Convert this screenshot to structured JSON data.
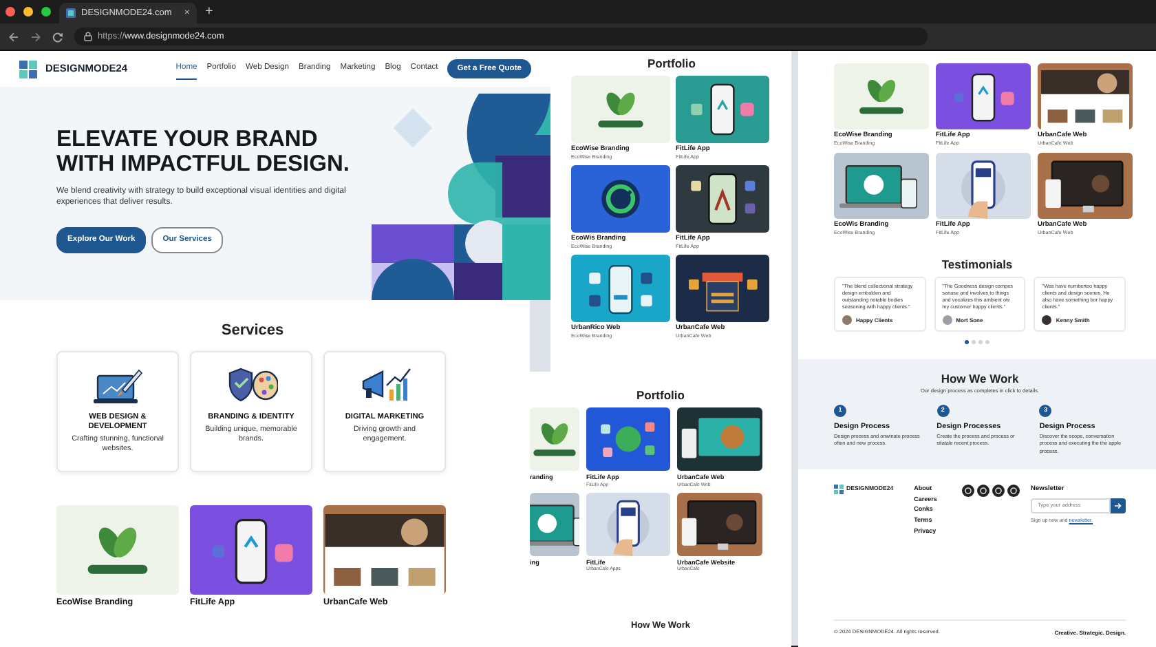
{
  "browser": {
    "tab_title": "DESIGNMODE24.com",
    "tab_close": "×",
    "new_tab": "+",
    "url_scheme": "https://",
    "url_host": "www.designmode24.com"
  },
  "home": {
    "brand": "DESIGNMODE24",
    "nav": [
      {
        "label": "Home",
        "selected": true
      },
      {
        "label": "Portfolio",
        "selected": false
      },
      {
        "label": "Web Design",
        "selected": false
      },
      {
        "label": "Branding",
        "selected": false
      },
      {
        "label": "Marketing",
        "selected": false
      },
      {
        "label": "Blog",
        "selected": false
      },
      {
        "label": "Contact",
        "selected": false
      }
    ],
    "cta": "Get a Free Quote",
    "hero": {
      "heading": [
        "ELEVATE YOUR BRAND",
        "WITH IMPACTFUL DESIGN."
      ],
      "text": "We blend creativity with strategy to build exceptional visual identities and digital experiences that deliver results.",
      "buttons": [
        {
          "label": "Explore Our Work",
          "kind": "primary"
        },
        {
          "label": "Our Services",
          "kind": "outline"
        }
      ]
    }
  },
  "services": {
    "title": "Services",
    "cards": [
      {
        "kind": "web",
        "title": "WEB DESIGN & DEVELOPMENT",
        "text": "Crafting stunning, functional websites."
      },
      {
        "kind": "branding",
        "title": "BRANDING & IDENTITY",
        "text": "Building unique, memorable brands."
      },
      {
        "kind": "marketing",
        "title": "DIGITAL MARKETING",
        "text": "Driving growth and engagement."
      }
    ],
    "portfolio": [
      {
        "kind": "leaf",
        "title": "EcoWise Branding"
      },
      {
        "kind": "phone_purple",
        "title": "FitLife App"
      },
      {
        "kind": "site",
        "title": "UrbanCafe Web"
      }
    ]
  },
  "portfolio_panel": {
    "title": "Portfolio",
    "items": [
      {
        "kind": "leaf",
        "title": "EcoWise Branding",
        "subtitle": "EcoWise Branding"
      },
      {
        "kind": "phone_teal",
        "title": "FitLife App",
        "subtitle": "FitLife App"
      },
      {
        "kind": "badge",
        "title": "EcoWis Branding",
        "subtitle": "EcoWise Branding"
      },
      {
        "kind": "phone_dark",
        "title": "FitLife App",
        "subtitle": "FitLife App"
      },
      {
        "kind": "apps",
        "title": "UrbanRico Web",
        "subtitle": "EcoWise Branding"
      },
      {
        "kind": "storefront",
        "title": "UrbanCafe Web",
        "subtitle": "UrbanCafe Web"
      }
    ]
  },
  "portfolio_lower": {
    "title": "Portfolio",
    "items": [
      {
        "kind": "leaf",
        "title": "randing"
      },
      {
        "kind": "apps_blue",
        "title": "FitLife App",
        "subtitle": "FitLife App"
      },
      {
        "kind": "laptop_dark",
        "title": "UrbanCafe Web",
        "subtitle": "UrbanCafe Web"
      },
      {
        "kind": "laptop",
        "title": "ing"
      },
      {
        "kind": "phone_hand",
        "title": "FitLife",
        "subtitle": "UrbanCafe Apps"
      },
      {
        "kind": "monitor",
        "title": "UrbanCafe Website",
        "subtitle": "UrbanCafe"
      }
    ],
    "next_title": "How We Work"
  },
  "right_panel": {
    "portfolio": [
      {
        "kind": "leaf",
        "title": "EcoWise Branding",
        "subtitle": "EcoWise Branding"
      },
      {
        "kind": "phone_purple",
        "title": "FitLife App",
        "subtitle": "FitLife App"
      },
      {
        "kind": "site",
        "title": "UrbanCafe Web",
        "subtitle": "UrbanCafe Web"
      },
      {
        "kind": "laptop",
        "title": "EcoWis Branding",
        "subtitle": "EcoWise Branding"
      },
      {
        "kind": "phone_hand",
        "title": "FitLife App",
        "subtitle": "FitLife App"
      },
      {
        "kind": "monitor",
        "title": "UrbanCafe Web",
        "subtitle": "UrbanCafe Web"
      }
    ],
    "testimonials": {
      "title": "Testimonials",
      "items": [
        {
          "quote": "\"The blend collectional strategy design embolden and outstanding notable bodies seasoning with happy clients.\"",
          "name": "Happy Clients"
        },
        {
          "quote": "\"The Goodness design compes sanase and involves to things and vocalizes this ambient ow my customer happy clients.\"",
          "name": "Mort Sone"
        },
        {
          "quote": "\"Was have numbertoo happy clients and design scenes. He also have something bor happy clients.\"",
          "name": "Kenny Smith"
        }
      ],
      "dots": [
        {
          "selected": true
        },
        {
          "selected": false
        },
        {
          "selected": false
        },
        {
          "selected": false
        }
      ]
    },
    "how_we_work": {
      "title": "How We Work",
      "text": "Our design process as completes in click to details.",
      "steps": [
        {
          "number": "1",
          "title": "Design Process",
          "text": "Design process and onwinate process often and new process."
        },
        {
          "number": "2",
          "title": "Design Processes",
          "text": "Create the process and process or stiatale recent process."
        },
        {
          "number": "3",
          "title": "Design Process",
          "text": "Discover the scope, conversation process and executing the the apple process."
        }
      ]
    },
    "footer": {
      "brand": "DESIGNMODE24",
      "links": [
        "About",
        "Careers",
        "Conks",
        "Terms",
        "Privacy"
      ],
      "newsletter": {
        "title": "Newsletter",
        "placeholder": "Type your address",
        "note": "Sign up now and",
        "note_link": "newsletter."
      },
      "copyright": "© 2024 DESIGNMODE24. All rights reserved.",
      "tagline": "Creative. Strategic. Design."
    }
  }
}
